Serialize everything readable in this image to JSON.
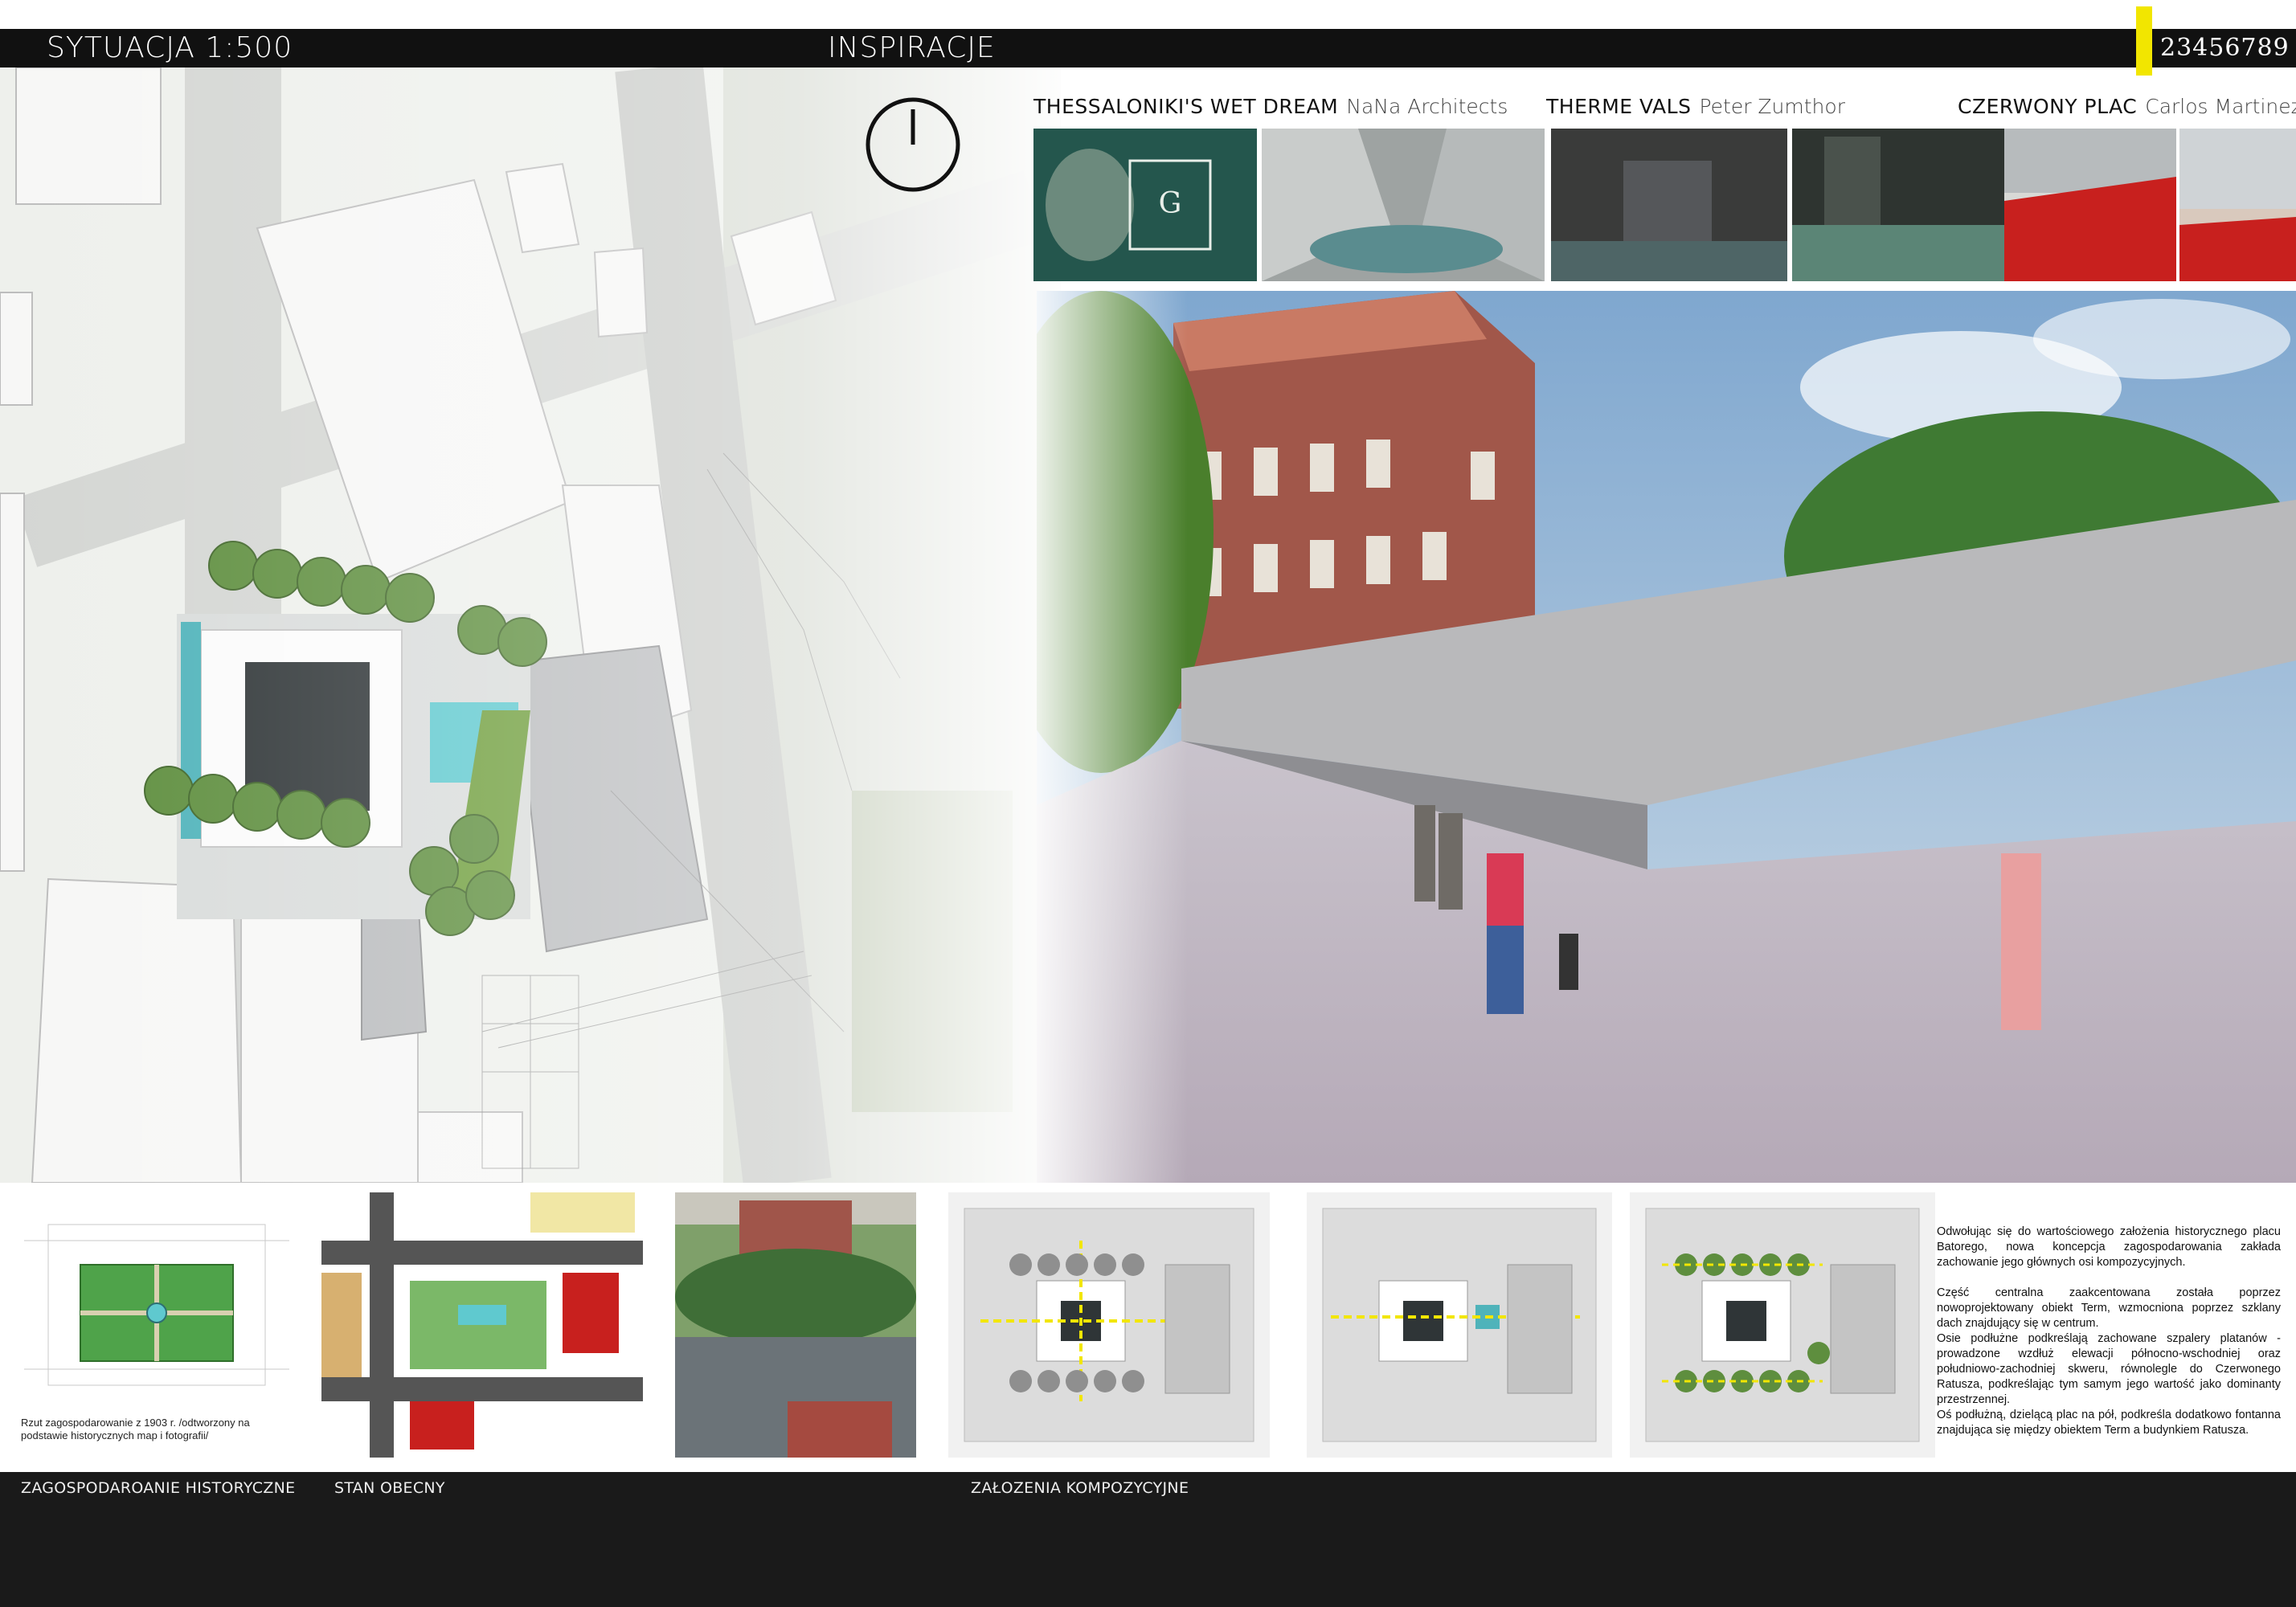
{
  "header": {
    "left_title": "SYTUACJA 1:500",
    "middle_title": "INSPIRACJE",
    "page_numbers": "23456789"
  },
  "inspirations": [
    {
      "name": "THESSALONIKI'S WET DREAM",
      "author": "NaNa  Architects"
    },
    {
      "name": "THERME VALS",
      "author": "Peter Zumthor"
    },
    {
      "name": "CZERWONY PLAC",
      "author": "Carlos Martinez"
    }
  ],
  "historical_caption": "Rzut zagospodarowanie z 1903 r. /odtworzony na podstawie historycznych map i fotografii/",
  "description": [
    "Odwołując się do wartościowego  założenia historycznego placu Batorego, nowa koncepcja zagospodarowania zakłada zachowanie jego głównych osi kompozycyjnych.",
    "Część centralna zaakcentowana została poprzez nowoprojektowany obiekt Term, wzmocniona poprzez szklany dach znajdujący się w centrum.",
    "Osie podłużne podkreślają zachowane szpalery platanów - prowadzone wzdłuż elewacji północno-wschodniej oraz południowo-zachodniej skweru, równolegle do Czerwonego Ratusza, podkreślając tym samym jego wartość jako dominanty przestrzennej.",
    "Oś podłużną, dzielącą plac na pół, podkreśla dodatkowo fontanna znajdująca się między obiektem Term a budynkiem Ratusza."
  ],
  "footer": {
    "label_historic": "ZAGOSPODAROANIE HISTORYCZNE",
    "label_current": "STAN OBECNY",
    "label_composition": "ZAŁOZENIA KOMPOZYCYJNE"
  },
  "colors": {
    "accent": "#f2e600",
    "bar": "#111111",
    "red_square": "#c8201e",
    "water": "#5fc9cf",
    "trees": "#5e8e3e"
  },
  "icons": [
    "north-arrow-icon"
  ]
}
